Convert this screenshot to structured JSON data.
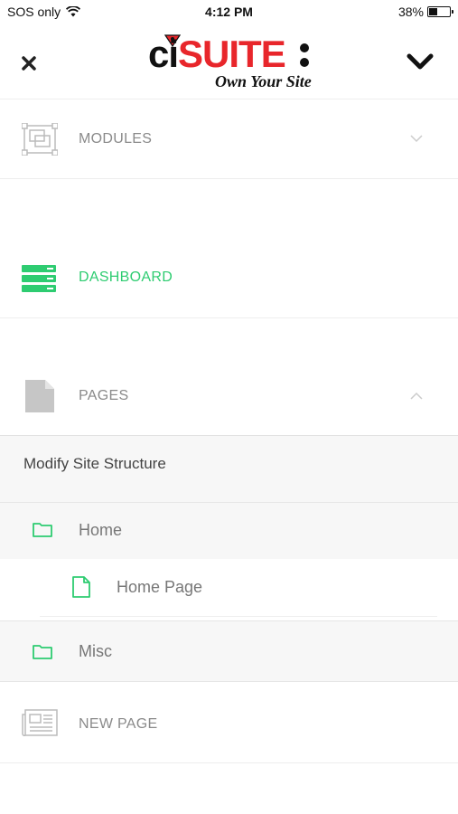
{
  "status_bar": {
    "carrier": "SOS only",
    "time": "4:12 PM",
    "battery": "38%"
  },
  "header": {
    "logo_ci": "ci",
    "logo_suite": "SUITE",
    "logo_tagline": "Own Your Site"
  },
  "menu": {
    "modules": {
      "label": "MODULES",
      "icon": "modules-icon"
    },
    "dashboard": {
      "label": "DASHBOARD",
      "icon": "dashboard-icon"
    },
    "pages": {
      "label": "PAGES",
      "icon": "document-icon"
    },
    "new_page": {
      "label": "NEW PAGE",
      "icon": "newspaper-icon"
    }
  },
  "pages_submenu": {
    "modify_label": "Modify Site Structure",
    "tree": [
      {
        "label": "Home",
        "icon": "folder-icon"
      },
      {
        "label": "Home Page",
        "icon": "file-icon"
      },
      {
        "label": "Misc",
        "icon": "folder-icon"
      }
    ]
  },
  "colors": {
    "accent_green": "#2ecc71",
    "brand_red": "#e8262b",
    "muted_gray": "#8a8a8a"
  }
}
